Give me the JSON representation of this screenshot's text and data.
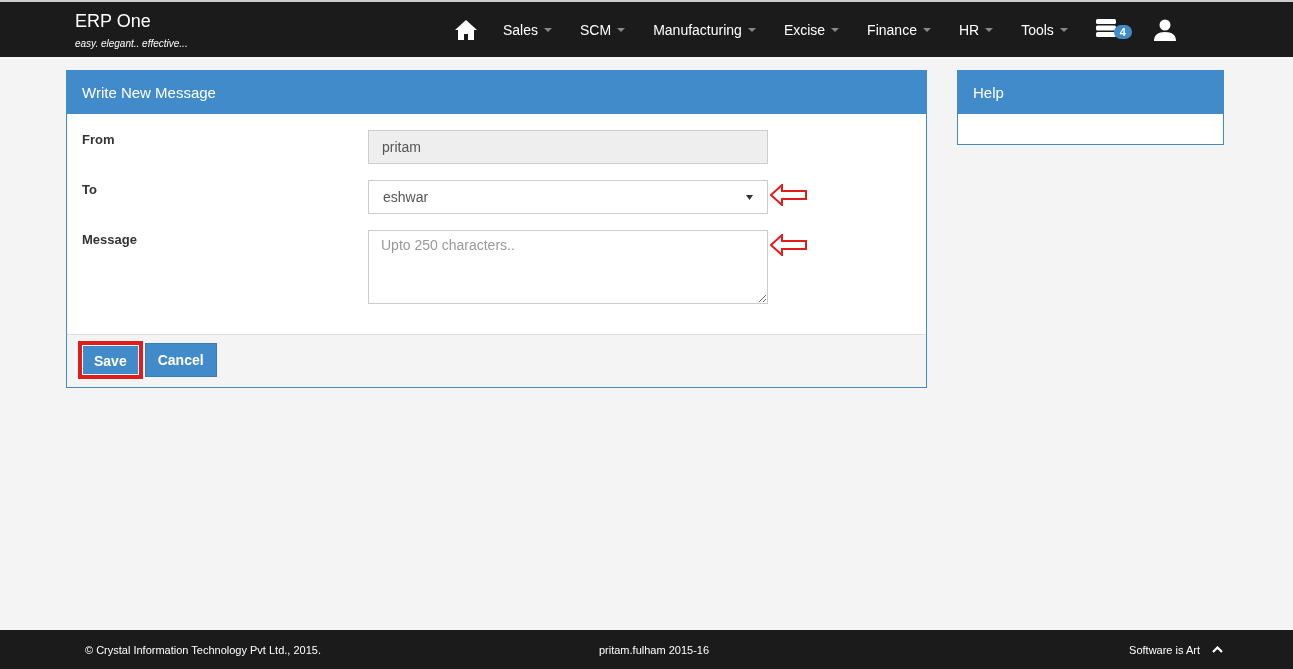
{
  "brand": {
    "title": "ERP One",
    "tagline": "easy. elegant.. effective..."
  },
  "nav": {
    "menus": [
      {
        "label": "Sales"
      },
      {
        "label": "SCM"
      },
      {
        "label": "Manufacturing"
      },
      {
        "label": "Excise"
      },
      {
        "label": "Finance"
      },
      {
        "label": "HR"
      },
      {
        "label": "Tools"
      }
    ],
    "notification_count": "4"
  },
  "form": {
    "title": "Write New Message",
    "fields": [
      {
        "kind": "readonly",
        "label": "From",
        "value": "pritam",
        "annotated": false
      },
      {
        "kind": "select",
        "label": "To",
        "value": "eshwar",
        "annotated": true
      },
      {
        "kind": "textarea",
        "label": "Message",
        "placeholder": "Upto 250 characters..",
        "annotated": true
      }
    ],
    "buttons": [
      {
        "label": "Save",
        "highlighted": true
      },
      {
        "label": "Cancel",
        "highlighted": false
      }
    ]
  },
  "help": {
    "title": "Help"
  },
  "footer": {
    "copyright": "© Crystal Information Technology Pvt Ltd., 2015.",
    "session": "pritam.fulham 2015-16",
    "slogan": "Software is Art"
  }
}
